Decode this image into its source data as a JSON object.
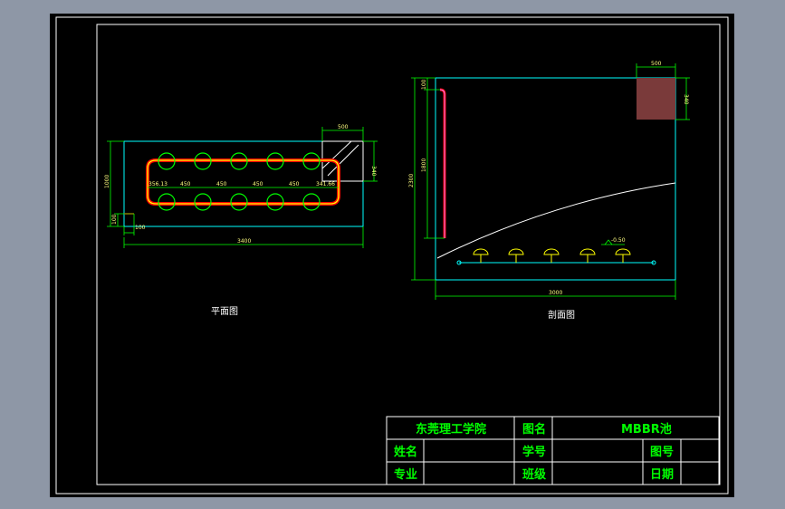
{
  "colors": {
    "background": "#8e97a6",
    "paper": "#000000",
    "frame": "#ffffff",
    "dimension": "#00ff00",
    "outline": "#00ffff",
    "pipe": "#ff0000",
    "pipe_inner": "#ffff00",
    "block": "#7a3a3a",
    "title_text": "#00ff00"
  },
  "plan_view": {
    "caption": "平面图",
    "dims": {
      "top_width": "500",
      "right_height": "340",
      "left_height": "1000",
      "left_small": "100",
      "bottom_small": "100",
      "total_width": "3400",
      "spacing_first": "356.13",
      "spacing_1": "450",
      "spacing_2": "450",
      "spacing_3": "450",
      "spacing_4": "450",
      "spacing_last": "341.66"
    }
  },
  "section_view": {
    "caption": "剖面图",
    "dims": {
      "block_width": "500",
      "block_height": "340",
      "left_top": "100",
      "left_total": "2300",
      "left_pipe": "1800",
      "bottom_width": "3000",
      "elevation": "-0.50"
    }
  },
  "title_block": {
    "school": "东莞理工学院",
    "drawing_name_label": "图名",
    "drawing_name": "MBBR池",
    "name_label": "姓名",
    "student_id_label": "学号",
    "drawing_no_label": "图号",
    "major_label": "专业",
    "class_label": "班级",
    "date_label": "日期",
    "name_value": "",
    "student_id_value": "",
    "drawing_no_value": "",
    "major_value": "",
    "class_value": "",
    "date_value": ""
  }
}
